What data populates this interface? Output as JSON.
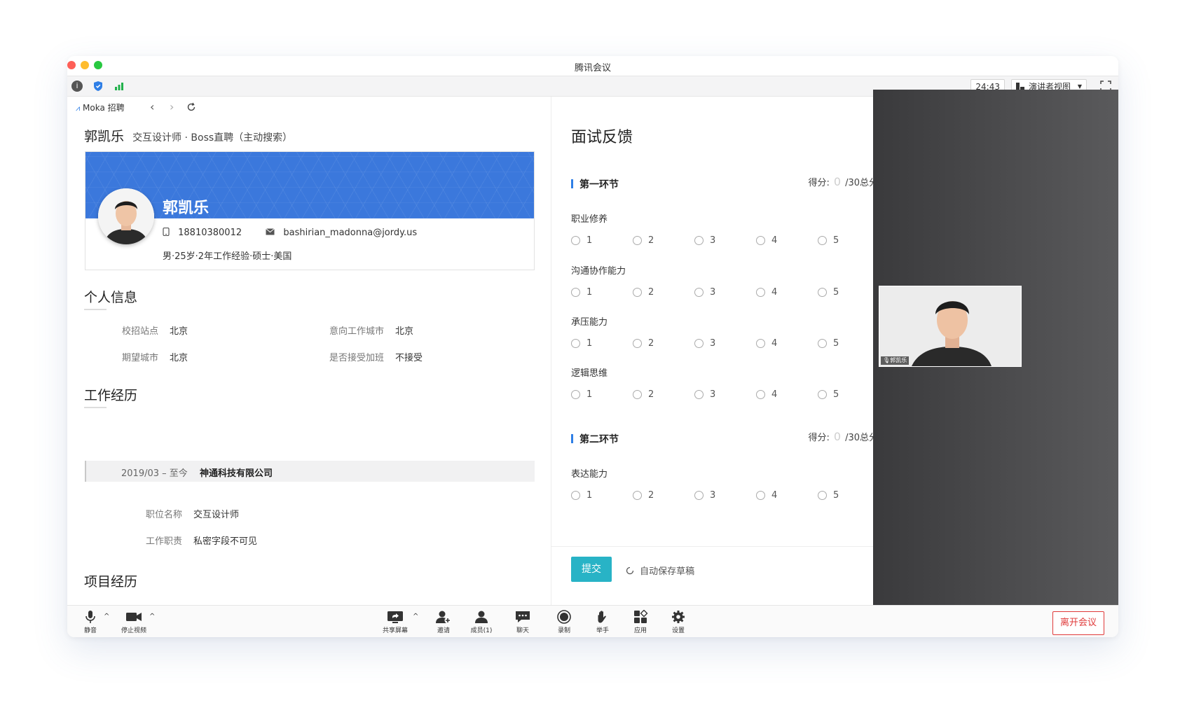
{
  "window": {
    "title": "腾讯会议"
  },
  "meeting_toolbar": {
    "timer": "24:43",
    "view_mode": "演讲者视图"
  },
  "browser": {
    "brand": "Moka 招聘"
  },
  "candidate": {
    "header_name": "郭凯乐",
    "header_sub": "交互设计师 · Boss直聘（主动搜索）",
    "card_name": "郭凯乐",
    "phone": "18810380012",
    "email": "bashirian_madonna@jordy.us",
    "meta": "男·25岁·2年工作经验·硕士·美国"
  },
  "personal_info": {
    "title": "个人信息",
    "fields": [
      {
        "label": "校招站点",
        "value": "北京"
      },
      {
        "label": "意向工作城市",
        "value": "北京"
      },
      {
        "label": "期望城市",
        "value": "北京"
      },
      {
        "label": "是否接受加班",
        "value": "不接受"
      }
    ]
  },
  "work_experience": {
    "title": "工作经历",
    "period": "2019/03 – 至今",
    "company": "神通科技有限公司",
    "fields": [
      {
        "label": "职位名称",
        "value": "交互设计师"
      },
      {
        "label": "工作职责",
        "value": "私密字段不可见"
      }
    ]
  },
  "project_experience": {
    "title": "项目经历"
  },
  "feedback": {
    "title": "面试反馈",
    "score_label": "得分:",
    "score_value": "0",
    "score_total": "/30总分",
    "sections": [
      {
        "name": "第一环节",
        "questions": [
          "职业修养",
          "沟通协作能力",
          "承压能力",
          "逻辑思维"
        ]
      },
      {
        "name": "第二环节",
        "questions": [
          "表达能力"
        ]
      }
    ],
    "options": [
      "1",
      "2",
      "3",
      "4",
      "5"
    ],
    "submit_label": "提交",
    "autosave_label": "自动保存草稿"
  },
  "video": {
    "participant_name": "郭凯乐"
  },
  "bottom_bar": {
    "mute": "静音",
    "stop_video": "停止视频",
    "share_screen": "共享屏幕",
    "invite": "邀请",
    "members": "成员(1)",
    "chat": "聊天",
    "record": "录制",
    "raise_hand": "举手",
    "apps": "应用",
    "settings": "设置",
    "leave": "离开会议"
  },
  "colors": {
    "accent_blue": "#2f7fe6",
    "banner_blue": "#3b78dc",
    "submit_teal": "#28b3c6",
    "leave_red": "#e03a3a"
  }
}
